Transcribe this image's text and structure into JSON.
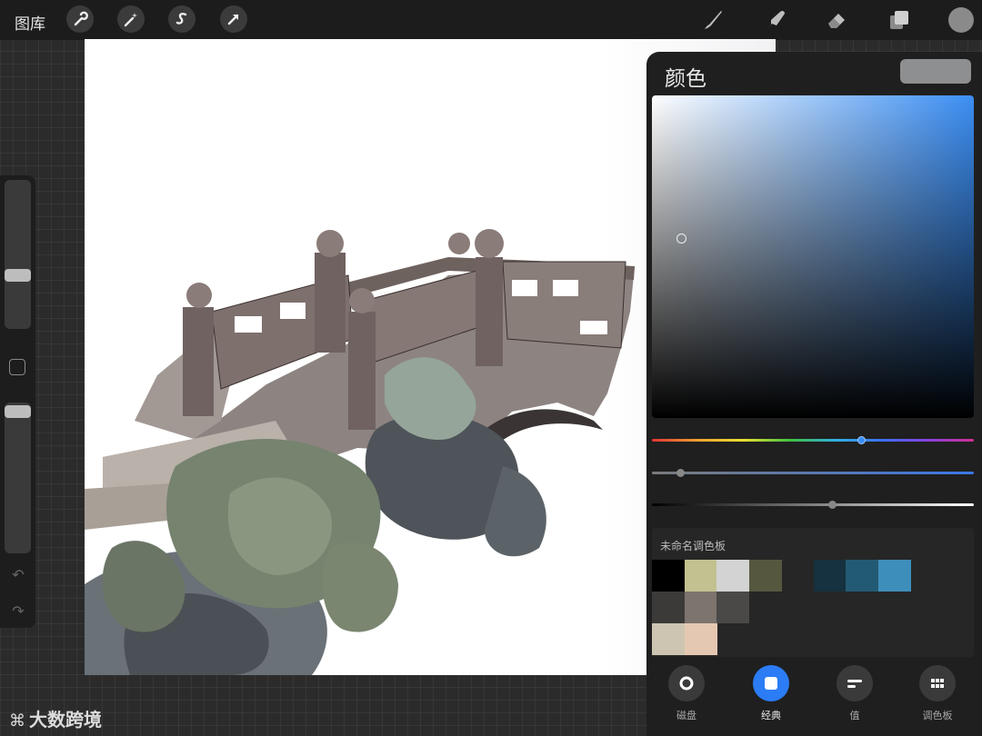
{
  "topbar": {
    "gallery_label": "图库",
    "tools_left": [
      "wrench-icon",
      "magic-wand-icon",
      "selection-icon",
      "transform-arrow-icon"
    ],
    "tools_right": [
      "brush-icon",
      "smudge-icon",
      "eraser-icon",
      "layers-icon",
      "current-color-icon"
    ]
  },
  "sidebar": {
    "brush_size_level": 0.65,
    "opacity_level": 0.0,
    "tools": [
      "modify-square-icon",
      "undo-icon",
      "redo-icon"
    ]
  },
  "color_panel": {
    "title": "颜色",
    "current_color": "#8e8f91",
    "hue_position": 0.65,
    "saturation_position": 0.09,
    "brightness_position": 0.56,
    "palette": {
      "title": "未命名调色板",
      "swatches": [
        "#000000",
        "#c2c190",
        "#d3d3d3",
        "#56573f",
        "",
        "#16313f",
        "#235a73",
        "#3e8ebb",
        "#3c3a39",
        "#7d746e",
        "#4a4948",
        "#cdc5b1",
        "#e5c8b2"
      ]
    },
    "tabs": [
      {
        "label": "磁盘",
        "icon": "ring-icon"
      },
      {
        "label": "经典",
        "icon": "square-icon",
        "active": true
      },
      {
        "label": "值",
        "icon": "sliders-icon"
      },
      {
        "label": "调色板",
        "icon": "grid-icon"
      }
    ]
  },
  "watermark": "大数跨境"
}
